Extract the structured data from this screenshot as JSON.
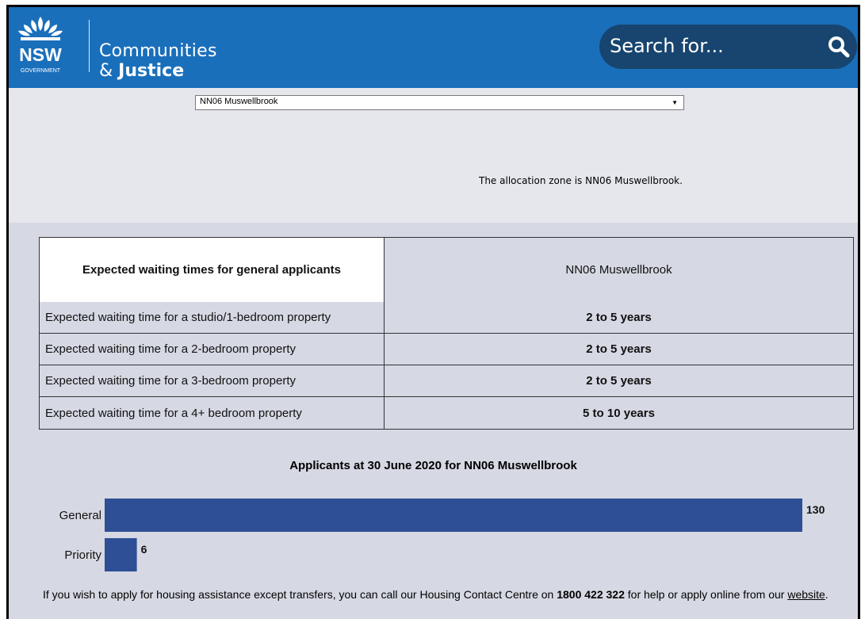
{
  "header": {
    "logo_text": "NSW",
    "logo_subtext": "GOVERNMENT",
    "brand_line1": "Communities",
    "brand_line2_amp": "&",
    "brand_line2": "Justice",
    "search_placeholder": "Search for..."
  },
  "zone_select": {
    "selected": "NN06 Muswellbrook"
  },
  "zone_text": "The allocation zone is NN06 Muswellbrook.",
  "table": {
    "header_left": "Expected waiting times for general applicants",
    "header_right": "NN06 Muswellbrook",
    "rows": [
      {
        "label": "Expected waiting time for a studio/1-bedroom property",
        "value": "2 to 5 years"
      },
      {
        "label": "Expected waiting time for a 2-bedroom property",
        "value": "2 to 5 years"
      },
      {
        "label": "Expected waiting time for a 3-bedroom property",
        "value": "2 to 5 years"
      },
      {
        "label": "Expected waiting time for a 4+ bedroom property",
        "value": "5 to 10 years"
      }
    ]
  },
  "chart_data": {
    "type": "bar",
    "orientation": "horizontal",
    "title": "Applicants at 30 June 2020 for NN06 Muswellbrook",
    "categories": [
      "General",
      "Priority"
    ],
    "values": [
      130,
      6
    ],
    "bar_color": "#2e4f96"
  },
  "footer": {
    "text_before": "If you wish to apply for housing assistance except transfers, you can call our Housing Contact Centre on",
    "phone": "1800 422 322",
    "text_middle": "for help or apply online from our",
    "link_text": "website",
    "text_end": "."
  },
  "colors": {
    "header_bg": "#1a6fbb",
    "search_bg": "#17456f",
    "page_bg": "#d6d9e3",
    "bar": "#2e4f96"
  }
}
